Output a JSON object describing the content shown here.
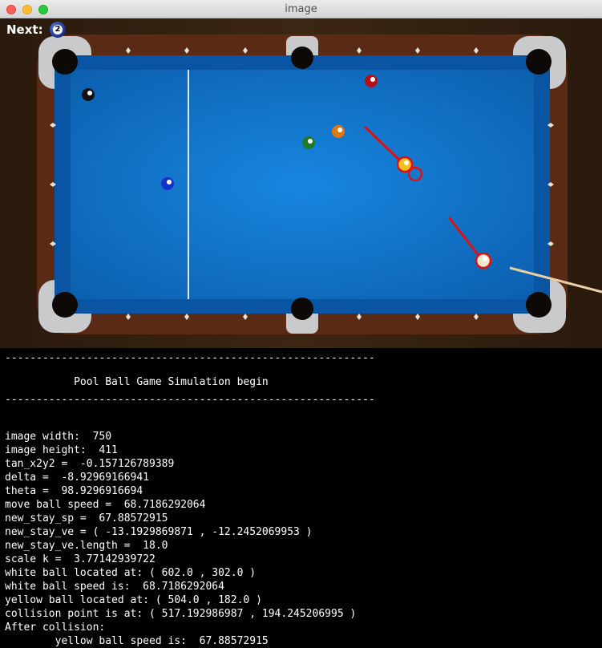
{
  "window": {
    "title": "image"
  },
  "hud": {
    "next_label": "Next:",
    "next_ball_number": "2"
  },
  "table": {
    "balls": [
      {
        "name": "black-ball",
        "color": "#111111"
      },
      {
        "name": "red-ball",
        "color": "#b3101a"
      },
      {
        "name": "orange-ball",
        "color": "#e07a10"
      },
      {
        "name": "green-ball",
        "color": "#1f7a2a"
      },
      {
        "name": "blue-ball",
        "color": "#1431c9"
      },
      {
        "name": "yellow-ball",
        "color": "#f2c21c"
      },
      {
        "name": "white-ball",
        "color": "#f0e6cc"
      }
    ],
    "felt_color": "#0f6fc4",
    "rail_color": "#5a2a14",
    "marker_color": "#e01010"
  },
  "console": {
    "separator": "-----------------------------------------------------------",
    "heading": "           Pool Ball Game Simulation begin",
    "lines": [
      "image width:  750",
      "image height:  411",
      "tan_x2y2 =  -0.157126789389",
      "delta =  -8.92969166941",
      "theta =  98.9296916694",
      "move ball speed =  68.7186292064",
      "new_stay_sp =  67.88572915",
      "new_stay_ve = ( -13.1929869871 , -12.2452069953 )",
      "new_stay_ve.length =  18.0",
      "scale k =  3.77142939722",
      "white ball located at: ( 602.0 , 302.0 )",
      "white ball speed is:  68.7186292064",
      "yellow ball located at: ( 504.0 , 182.0 )",
      "collision point is at: ( 517.192986987 , 194.245206995 )",
      "After collision:",
      "        yellow ball speed is:  67.88572915"
    ]
  }
}
